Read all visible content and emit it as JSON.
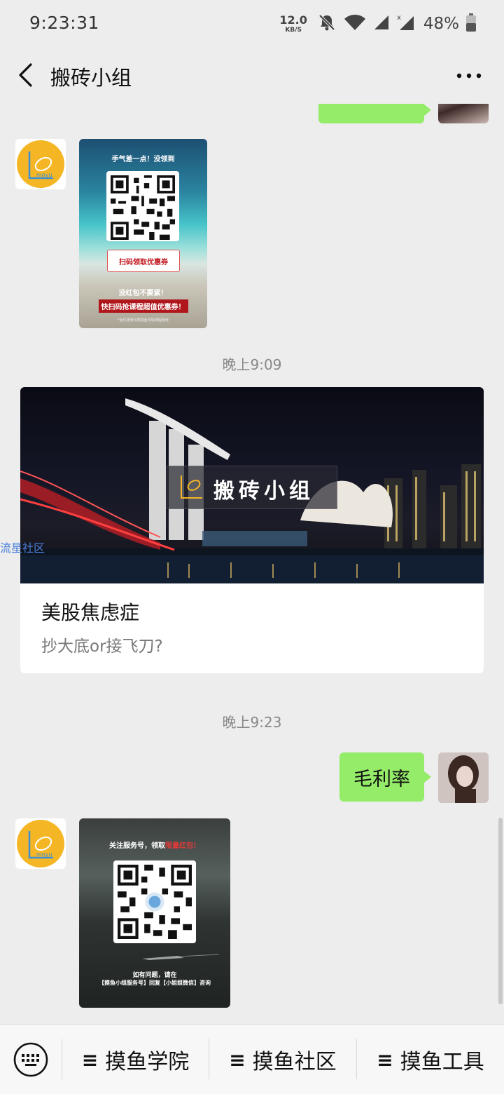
{
  "status_bar": {
    "time": "9:23:31",
    "net_speed": "12.0",
    "net_unit": "KB/S",
    "battery": "48%",
    "icons": [
      "bell-muted-icon",
      "wifi-icon",
      "signal-icon",
      "signal-x-icon",
      "battery-icon"
    ]
  },
  "nav": {
    "title": "搬砖小组",
    "back_icon": "chevron-left-icon",
    "more_icon": "more-dots-icon"
  },
  "messages": {
    "poster1": {
      "header": "手气差一点！没领到",
      "button": "扫码领取优惠券",
      "line1": "没红包不要紧！",
      "line2": "快扫码抢课程超值优惠券！",
      "fine": "*此优惠券仅限摸鱼学院课程使用"
    },
    "time1": "晚上9:09",
    "article": {
      "brand": "搬砖小组",
      "title": "美股焦虑症",
      "subtitle": "抄大底or接飞刀?"
    },
    "time2": "晚上9:23",
    "sent_text": "毛利率",
    "poster2": {
      "header_a": "关注服务号，领取",
      "header_b": "限量红包！",
      "line1": "如有问题，请在",
      "line2": "【摸鱼小组服务号】回复【小姐姐微信】咨询"
    }
  },
  "watermark": "流星社区",
  "bottom_menu": {
    "keyboard_icon": "keyboard-icon",
    "items": [
      "摸鱼学院",
      "摸鱼社区",
      "摸鱼工具"
    ],
    "menu_icon": "≡"
  },
  "colors": {
    "background": "#ededed",
    "sent_bubble": "#95ec69",
    "avatar_logo": "#f5b625"
  }
}
